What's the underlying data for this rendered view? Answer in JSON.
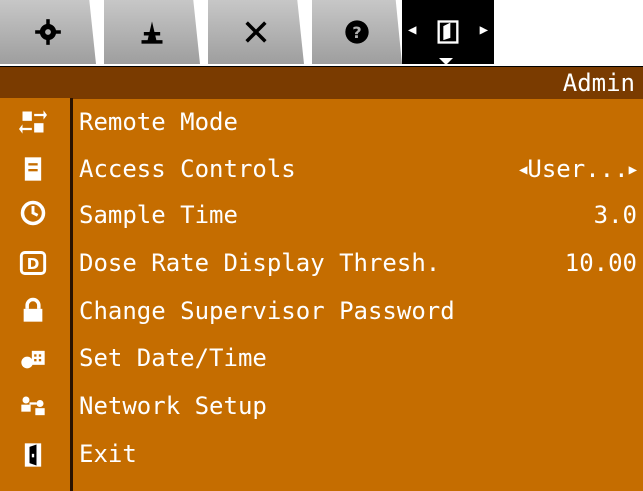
{
  "tabs": [
    {
      "icon": "gear-icon"
    },
    {
      "icon": "antenna-icon"
    },
    {
      "icon": "tools-icon"
    },
    {
      "icon": "help-icon"
    },
    {
      "icon": "admin-door-icon",
      "active": true
    }
  ],
  "title": "Admin",
  "menu": [
    {
      "label": "Remote Mode",
      "value": "",
      "icon": "transfer-arrows-icon"
    },
    {
      "label": "Access Controls",
      "value": "User...",
      "icon": "document-icon"
    },
    {
      "label": "Sample Time",
      "value": "3.0",
      "icon": "clock-icon"
    },
    {
      "label": "Dose Rate Display Thresh.",
      "value": "10.00",
      "icon": "display-d-icon"
    },
    {
      "label": "Change Supervisor Password",
      "value": "",
      "icon": "lock-icon"
    },
    {
      "label": "Set Date/Time",
      "value": "",
      "icon": "calendar-icon"
    },
    {
      "label": "Network Setup",
      "value": "",
      "icon": "network-icon"
    },
    {
      "label": "Exit",
      "value": "",
      "icon": "exit-door-icon"
    }
  ],
  "colors": {
    "background": "#c56d00",
    "titlebar": "#7a3b00",
    "text": "#ffffff"
  }
}
